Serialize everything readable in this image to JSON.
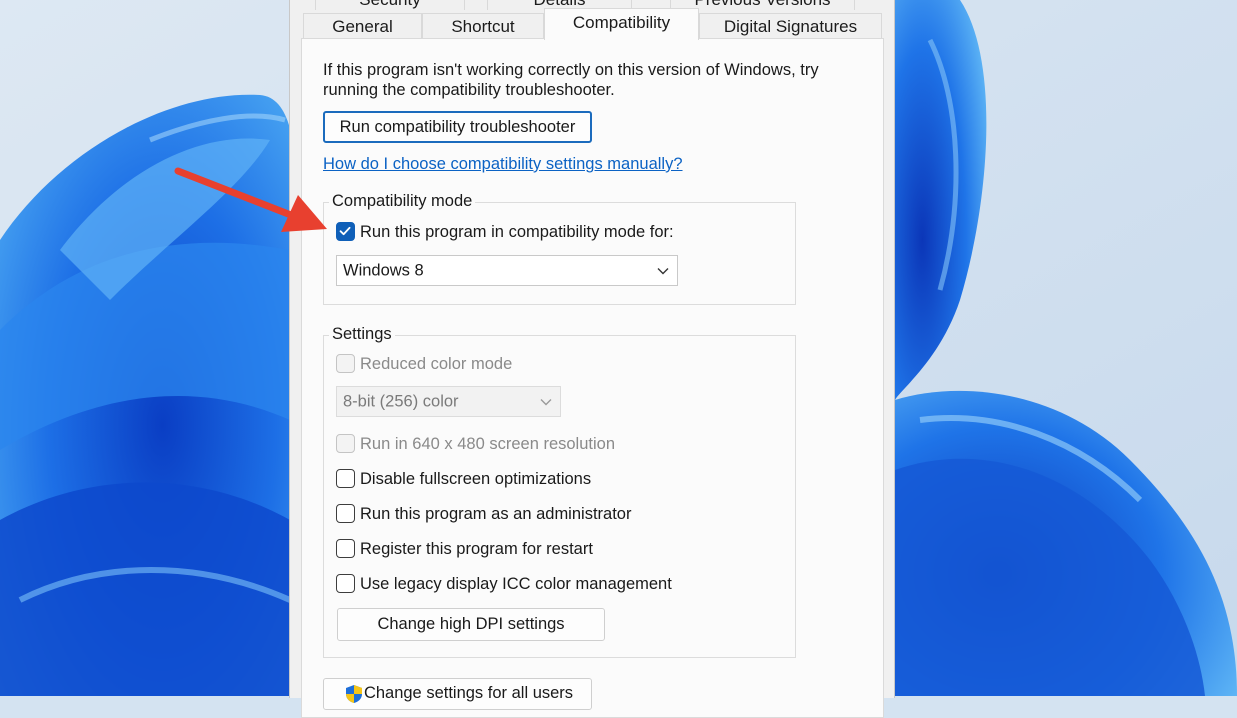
{
  "tabs_back": [
    "Security",
    "Details",
    "Previous Versions"
  ],
  "tabs_front": [
    "General",
    "Shortcut",
    "Compatibility",
    "Digital Signatures"
  ],
  "intro": {
    "line1": "If this program isn't working correctly on this version of Windows, try",
    "line2": "running the compatibility troubleshooter."
  },
  "troubleshooter_button": "Run compatibility troubleshooter",
  "manual_link": "How do I choose compatibility settings manually?",
  "compat_mode": {
    "legend": "Compatibility mode",
    "checkbox_label": "Run this program in compatibility mode for:",
    "checked": true,
    "selected_os": "Windows 8"
  },
  "settings": {
    "legend": "Settings",
    "reduced_color_label": "Reduced color mode",
    "color_select": "8-bit (256) color",
    "resolution_label": "Run in 640 x 480 screen resolution",
    "fullscreen_label": "Disable fullscreen optimizations",
    "admin_label": "Run this program as an administrator",
    "restart_label": "Register this program for restart",
    "icc_label": "Use legacy display ICC color management",
    "dpi_button": "Change high DPI settings"
  },
  "all_users_button": "Change settings for all users",
  "colors": {
    "accent": "#0f5fb8",
    "annotation_arrow": "#e8402f"
  }
}
